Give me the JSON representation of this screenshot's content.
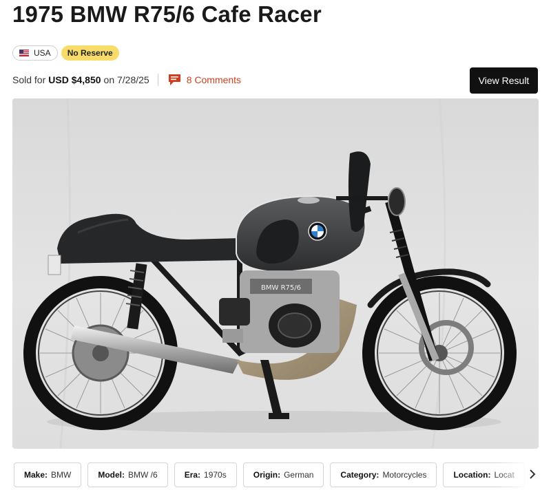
{
  "listing": {
    "title": "1975 BMW R75/6 Cafe Racer",
    "country": "USA",
    "reserve_badge": "No Reserve",
    "sold_prefix": "Sold for",
    "price": "USD $4,850",
    "date_text": "on 7/28/25",
    "comments_label": "8 Comments",
    "view_result_label": "View Result"
  },
  "hero_image": {
    "tank_badge_text": "BMW",
    "engine_plate_text": "BMW R75/6"
  },
  "colors": {
    "accent_red": "#cf3f1f",
    "reserve_yellow": "#f8dc6a",
    "button_black": "#111111"
  },
  "icons": {
    "flag": "us-flag-icon",
    "comments": "comment-bubble-icon",
    "next": "chevron-right-icon"
  },
  "attributes": [
    {
      "key": "Make:",
      "value": "BMW"
    },
    {
      "key": "Model:",
      "value": "BMW /6"
    },
    {
      "key": "Era:",
      "value": "1970s"
    },
    {
      "key": "Origin:",
      "value": "German"
    },
    {
      "key": "Category:",
      "value": "Motorcycles"
    },
    {
      "key": "Location:",
      "value": "Locat"
    }
  ]
}
